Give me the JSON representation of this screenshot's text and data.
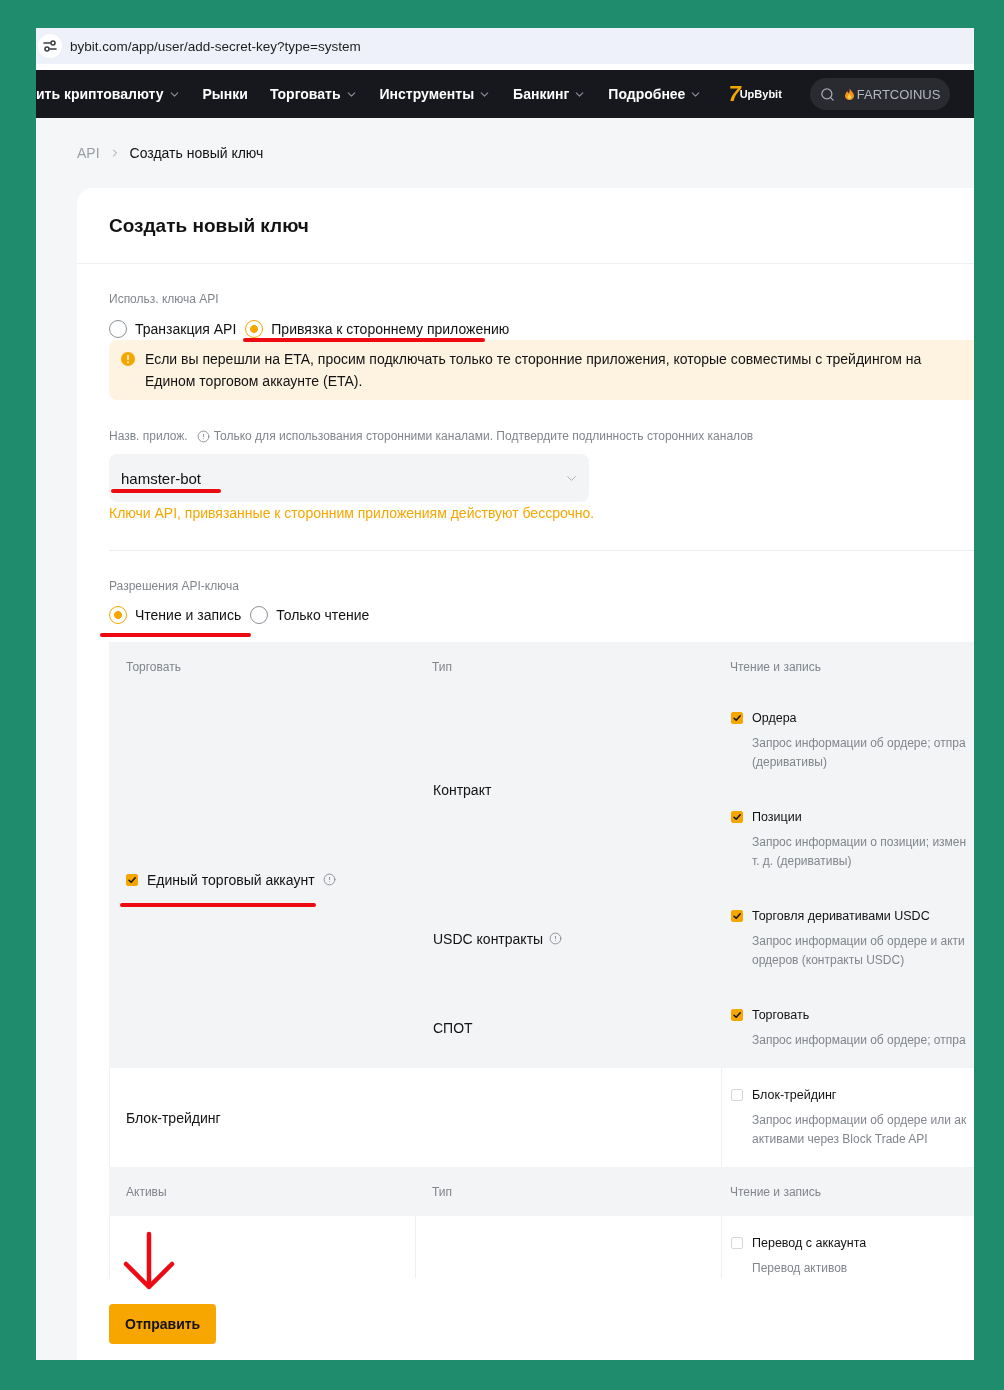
{
  "browser": {
    "url": "bybit.com/app/user/add-secret-key?type=system"
  },
  "nav": {
    "items": [
      {
        "label": "ить криптовалюту",
        "dropdown": true
      },
      {
        "label": "Рынки",
        "dropdown": false
      },
      {
        "label": "Торговать",
        "dropdown": true
      },
      {
        "label": "Инструменты",
        "dropdown": true
      },
      {
        "label": "Банкинг",
        "dropdown": true
      },
      {
        "label": "Подробнее",
        "dropdown": true
      }
    ],
    "logo": {
      "mark": "7",
      "name": "UpBybit"
    },
    "search": {
      "placeholder": "FARTCOINUS"
    }
  },
  "breadcrumb": [
    {
      "label": "API",
      "current": false
    },
    {
      "label": "Создать новый ключ",
      "current": true
    }
  ],
  "title": "Создать новый ключ",
  "usage": {
    "label": "Использ. ключа API",
    "options": [
      {
        "label": "Транзакция API",
        "selected": false,
        "annotated": false
      },
      {
        "label": "Привязка к стороннему приложению",
        "selected": true,
        "annotated": true
      }
    ]
  },
  "warning": "Если вы перешли на ETA, просим подключать только те сторонние приложения, которые совместимы с трейдингом на Едином торговом аккаунте (ETA).",
  "app_name": {
    "label": "Назв. прилож.",
    "hint": "Только для использования сторонними каналами. Подтвердите подлинность сторонних каналов",
    "value": "hamster-bot",
    "annotated": true
  },
  "note": "Ключи API, привязанные к сторонним приложениям действуют бессрочно.",
  "permissions": {
    "label": "Разрешения API-ключа",
    "options": [
      {
        "label": "Чтение и запись",
        "selected": true,
        "annotated": true
      },
      {
        "label": "Только чтение",
        "selected": false,
        "annotated": false
      }
    ]
  },
  "table": {
    "sections": [
      {
        "columns": [
          "Торговать",
          "Тип",
          "Чтение и запись"
        ],
        "groups": [
          {
            "kind": "account",
            "name": "Единый торговый аккаунт",
            "checked": true,
            "info": true,
            "annotated": true,
            "types": [
              {
                "name": "Контракт",
                "info": false,
                "permissions": [
                  {
                    "label": "Ордера",
                    "checked": true,
                    "description": [
                      "Запрос информации об ордере; отпра",
                      "(деривативы)"
                    ]
                  },
                  {
                    "label": "Позиции",
                    "checked": true,
                    "description": [
                      "Запрос информации о позиции; измен",
                      "т. д. (деривативы)"
                    ]
                  }
                ]
              },
              {
                "name": "USDC контракты",
                "info": true,
                "permissions": [
                  {
                    "label": "Торговля деривативами USDC",
                    "checked": true,
                    "description": [
                      "Запрос информации об ордере и акти",
                      "ордеров (контракты USDC)"
                    ]
                  }
                ]
              },
              {
                "name": "СПОТ",
                "info": false,
                "permissions": [
                  {
                    "label": "Торговать",
                    "checked": true,
                    "description": [
                      "Запрос информации об ордере; отпра"
                    ]
                  }
                ]
              }
            ]
          },
          {
            "kind": "feature",
            "name": "Блок-трейдинг",
            "permissions": [
              {
                "label": "Блок-трейдинг",
                "checked": false,
                "description": [
                  "Запрос информации об ордере или ак",
                  "активами через Block Trade API"
                ]
              }
            ]
          }
        ]
      },
      {
        "columns": [
          "Активы",
          "Тип",
          "Чтение и запись"
        ],
        "groups": [
          {
            "kind": "asset",
            "permissions": [
              {
                "label": "Перевод с аккаунта",
                "checked": false,
                "description": [
                  "Перевод активов"
                ]
              }
            ]
          }
        ]
      }
    ]
  },
  "submit": {
    "label": "Отправить",
    "arrow": true
  }
}
